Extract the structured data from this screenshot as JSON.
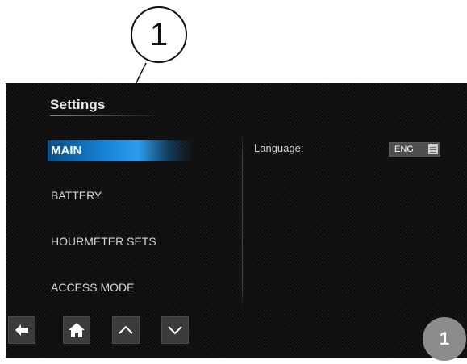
{
  "callout": {
    "number": "1"
  },
  "screen": {
    "title": "Settings",
    "menu": [
      {
        "label": "MAIN",
        "active": true
      },
      {
        "label": "BATTERY",
        "active": false
      },
      {
        "label": "HOURMETER SETS",
        "active": false
      },
      {
        "label": "ACCESS MODE",
        "active": false
      }
    ],
    "language": {
      "label": "Language:",
      "value": "ENG"
    },
    "nav_icons": [
      "back-arrow-icon",
      "home-icon",
      "chevron-up-icon",
      "chevron-down-icon"
    ]
  },
  "badge": {
    "number": "1"
  },
  "colors": {
    "accent": "#1784d6",
    "screen_bg": "#0b0b0c",
    "button_bg": "#3b3b3b",
    "badge_bg": "#8c8c8c"
  }
}
